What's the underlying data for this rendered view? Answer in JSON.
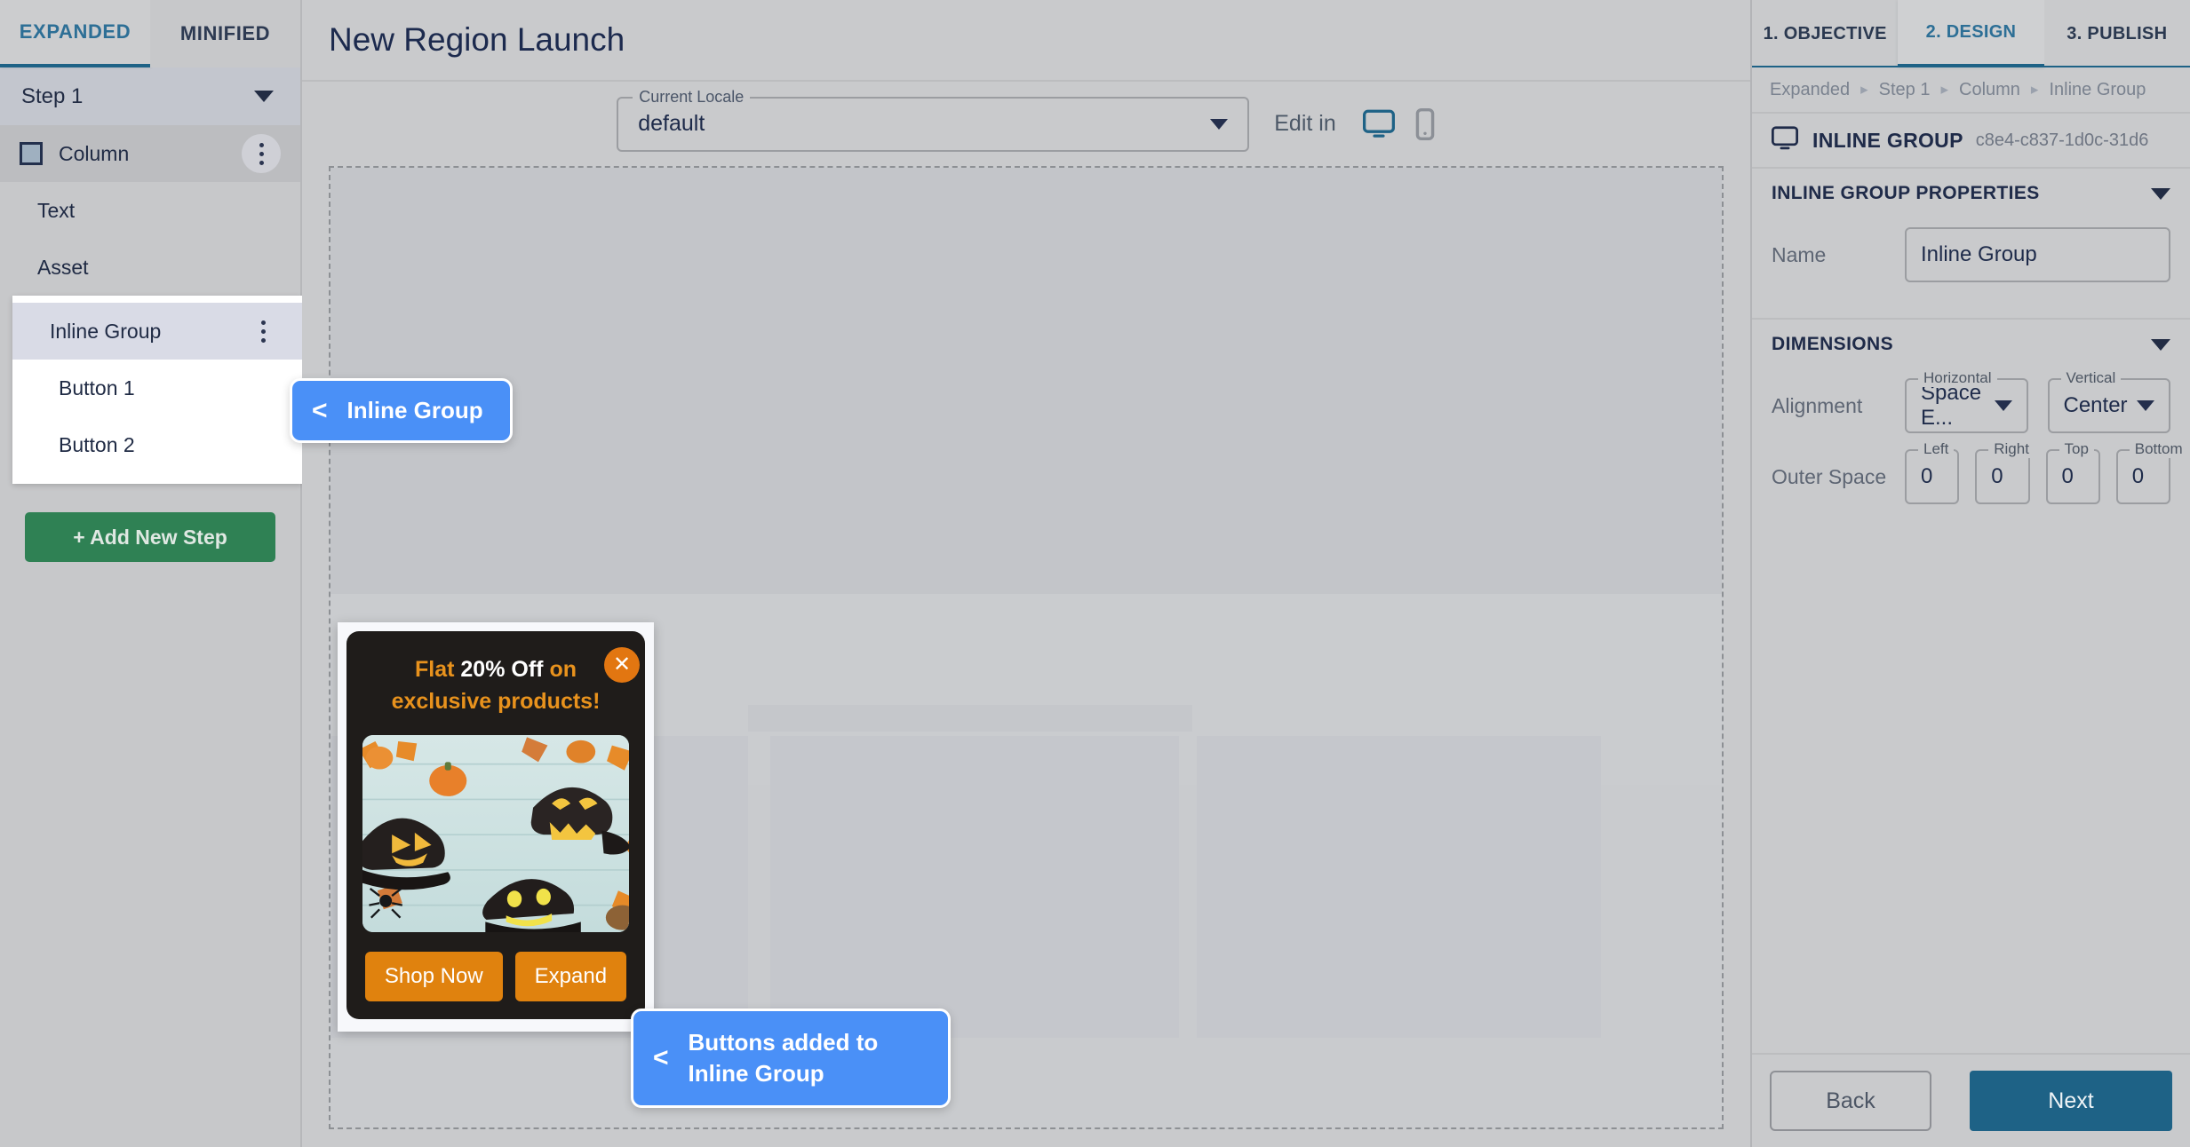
{
  "sidebar": {
    "tabs": [
      {
        "label": "EXPANDED",
        "active": true
      },
      {
        "label": "MINIFIED",
        "active": false
      }
    ],
    "step_selector": {
      "label": "Step 1"
    },
    "tree": [
      {
        "label": "Column",
        "icon": "square-icon",
        "menu": "kebab-icon"
      },
      {
        "label": "Text"
      },
      {
        "label": "Asset"
      },
      {
        "label": "Inline Group",
        "menu": "kebab-icon"
      },
      {
        "label": "Button 1"
      },
      {
        "label": "Button 2"
      }
    ],
    "add_step_label": "+ Add New Step"
  },
  "header": {
    "title": "New Region Launch"
  },
  "toolbar": {
    "locale": {
      "legend": "Current Locale",
      "value": "default"
    },
    "edit_in_label": "Edit in",
    "devices": [
      {
        "name": "desktop-icon",
        "active": true
      },
      {
        "name": "mobile-icon",
        "active": false
      }
    ]
  },
  "creative": {
    "close_label": "✕",
    "promo": {
      "line1_a": "Flat ",
      "line1_b": "20% Off",
      "line1_c": " on",
      "line2": "exclusive products!"
    },
    "buttons": [
      {
        "label": "Shop Now"
      },
      {
        "label": "Expand"
      }
    ]
  },
  "callouts": [
    {
      "arrow": "<",
      "text": "Inline Group"
    },
    {
      "arrow": "<",
      "text": "Buttons added to Inline Group"
    }
  ],
  "right_panel": {
    "tabs": [
      {
        "label": "1. OBJECTIVE",
        "active": false
      },
      {
        "label": "2. DESIGN",
        "active": true
      },
      {
        "label": "3. PUBLISH",
        "active": false
      }
    ],
    "breadcrumb": [
      "Expanded",
      "Step 1",
      "Column",
      "Inline Group"
    ],
    "breadcrumb_separator": "▸",
    "object": {
      "icon": "monitor-icon",
      "title": "INLINE GROUP",
      "id": "c8e4-c837-1d0c-31d6"
    },
    "properties_section": {
      "title": "INLINE GROUP PROPERTIES",
      "name_label": "Name",
      "name_value": "Inline Group"
    },
    "dimensions_section": {
      "title": "DIMENSIONS",
      "alignment_label": "Alignment",
      "horizontal": {
        "legend": "Horizontal",
        "value": "Space E..."
      },
      "vertical": {
        "legend": "Vertical",
        "value": "Center"
      },
      "outer_space_label": "Outer Space",
      "outer_space": [
        {
          "legend": "Left",
          "value": "0"
        },
        {
          "legend": "Right",
          "value": "0"
        },
        {
          "legend": "Top",
          "value": "0"
        },
        {
          "legend": "Bottom",
          "value": "0"
        }
      ]
    },
    "footer": {
      "back_label": "Back",
      "next_label": "Next"
    }
  },
  "colors": {
    "accent_blue": "#1e6286",
    "callout_blue": "#4a90f7",
    "promo_orange": "#e0820e",
    "add_step_green": "#2f8154"
  }
}
